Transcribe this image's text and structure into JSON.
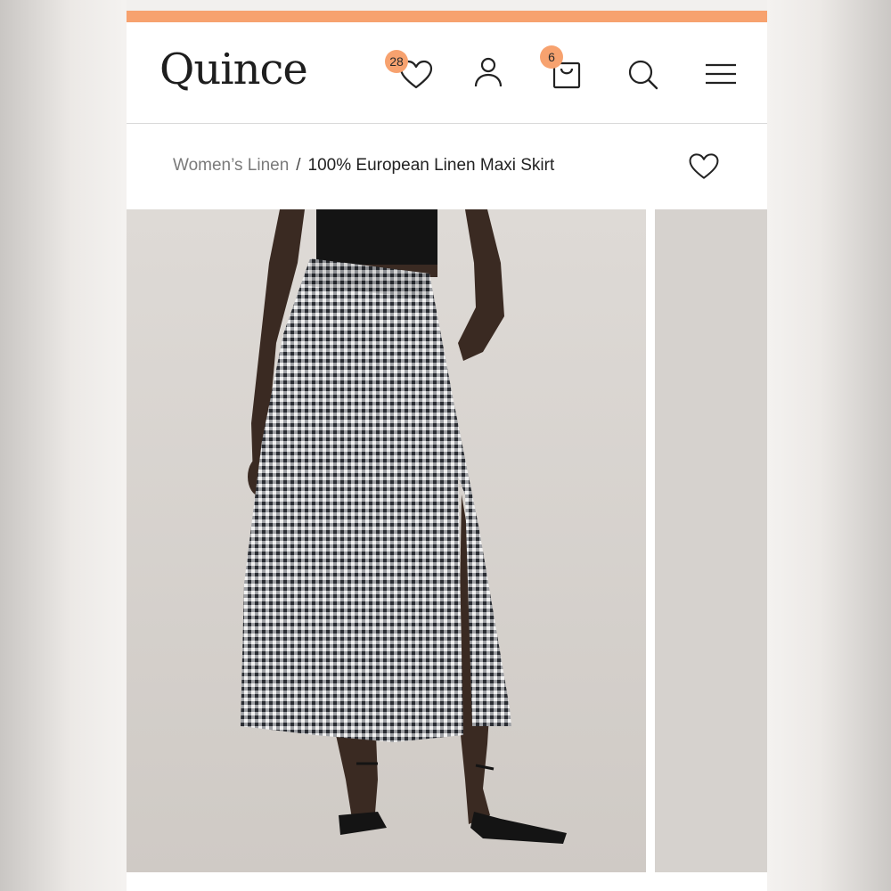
{
  "header": {
    "logo": "Quince",
    "wishlist_count": "28",
    "cart_count": "6",
    "icons": [
      "heart-icon",
      "user-icon",
      "bag-icon",
      "search-icon",
      "menu-icon"
    ]
  },
  "breadcrumb": {
    "parent": "Women’s Linen",
    "separator": "/",
    "current": "100% European Linen Maxi Skirt"
  },
  "product": {
    "wishlist_icon": "heart-outline-icon"
  },
  "colors": {
    "accent": "#f7a26f",
    "badge": "#f7a26f",
    "text": "#1e1e1e",
    "muted": "#7a7a7a"
  }
}
